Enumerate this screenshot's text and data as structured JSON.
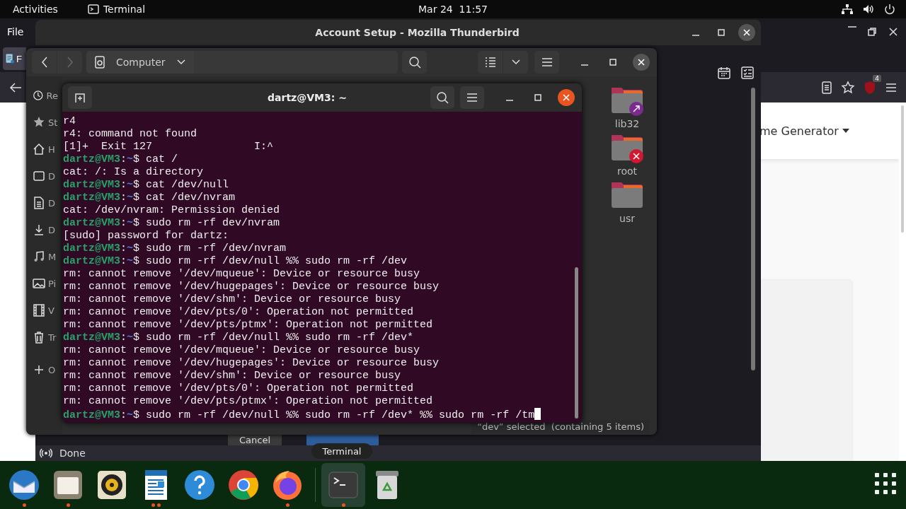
{
  "top_bar": {
    "activities": "Activities",
    "app": "Terminal",
    "clock": "Mar 24  11:57"
  },
  "browser": {
    "menu": "File",
    "tab_label": "F",
    "page_heading": "me Generator",
    "extension_badge": "4"
  },
  "thunderbird": {
    "title": "Account Setup - Mozilla Thunderbird",
    "buttons": [
      "Cancel"
    ],
    "status": "Done"
  },
  "files": {
    "location": "Computer",
    "sidebar": [
      {
        "kind": "recent",
        "label": "Re"
      },
      {
        "kind": "starred",
        "label": "St"
      },
      {
        "kind": "home",
        "label": "H"
      },
      {
        "kind": "desktop",
        "label": "D"
      },
      {
        "kind": "documents",
        "label": "D"
      },
      {
        "kind": "downloads",
        "label": "D"
      },
      {
        "kind": "music",
        "label": "M"
      },
      {
        "kind": "pictures",
        "label": "Pi"
      },
      {
        "kind": "videos",
        "label": "V"
      },
      {
        "kind": "trash",
        "label": "Tr"
      },
      {
        "kind": "other",
        "label": "O"
      }
    ],
    "folders": [
      {
        "kind": "link",
        "name": "lib32"
      },
      {
        "kind": "blocked",
        "name": "root"
      },
      {
        "kind": "plain",
        "name": "usr"
      }
    ],
    "status": "“dev” selected  (containing 5 items)"
  },
  "terminal": {
    "title": "dartz@VM3: ~",
    "cursor": true,
    "lines": [
      {
        "kind": "output",
        "text": "r4"
      },
      {
        "kind": "output",
        "text": "r4: command not found"
      },
      {
        "kind": "output",
        "text": "[1]+  Exit 127                I:^"
      },
      {
        "kind": "prompt",
        "user": "dartz@VM3",
        "colon": ":",
        "path": "~",
        "command": "$ cat /"
      },
      {
        "kind": "output",
        "text": "cat: /: Is a directory"
      },
      {
        "kind": "prompt",
        "user": "dartz@VM3",
        "colon": ":",
        "path": "~",
        "command": "$ cat /dev/null"
      },
      {
        "kind": "prompt",
        "user": "dartz@VM3",
        "colon": ":",
        "path": "~",
        "command": "$ cat /dev/nvram"
      },
      {
        "kind": "output",
        "text": "cat: /dev/nvram: Permission denied"
      },
      {
        "kind": "prompt",
        "user": "dartz@VM3",
        "colon": ":",
        "path": "~",
        "command": "$ sudo rm -rf dev/nvram"
      },
      {
        "kind": "output",
        "text": "[sudo] password for dartz:"
      },
      {
        "kind": "prompt",
        "user": "dartz@VM3",
        "colon": ":",
        "path": "~",
        "command": "$ sudo rm -rf /dev/nvram"
      },
      {
        "kind": "prompt",
        "user": "dartz@VM3",
        "colon": ":",
        "path": "~",
        "command": "$ sudo rm -rf /dev/null %% sudo rm -rf /dev"
      },
      {
        "kind": "output",
        "text": "rm: cannot remove '/dev/mqueue': Device or resource busy"
      },
      {
        "kind": "output",
        "text": "rm: cannot remove '/dev/hugepages': Device or resource busy"
      },
      {
        "kind": "output",
        "text": "rm: cannot remove '/dev/shm': Device or resource busy"
      },
      {
        "kind": "output",
        "text": "rm: cannot remove '/dev/pts/0': Operation not permitted"
      },
      {
        "kind": "output",
        "text": "rm: cannot remove '/dev/pts/ptmx': Operation not permitted"
      },
      {
        "kind": "prompt",
        "user": "dartz@VM3",
        "colon": ":",
        "path": "~",
        "command": "$ sudo rm -rf /dev/null %% sudo rm -rf /dev*"
      },
      {
        "kind": "output",
        "text": "rm: cannot remove '/dev/mqueue': Device or resource busy"
      },
      {
        "kind": "output",
        "text": "rm: cannot remove '/dev/hugepages': Device or resource busy"
      },
      {
        "kind": "output",
        "text": "rm: cannot remove '/dev/shm': Device or resource busy"
      },
      {
        "kind": "output",
        "text": "rm: cannot remove '/dev/pts/0': Operation not permitted"
      },
      {
        "kind": "output",
        "text": "rm: cannot remove '/dev/pts/ptmx': Operation not permitted"
      },
      {
        "kind": "prompt",
        "user": "dartz@VM3",
        "colon": ":",
        "path": "~",
        "command": "$ sudo rm -rf /dev/null %% sudo rm -rf /dev* %% sudo rm -rf /tm"
      }
    ]
  },
  "dock": {
    "tooltip": "Terminal",
    "apps": [
      {
        "kind": "mail",
        "running": true,
        "several": false,
        "selected": false
      },
      {
        "kind": "files",
        "running": true,
        "several": false,
        "selected": false
      },
      {
        "kind": "audio",
        "running": false,
        "selected": false
      },
      {
        "kind": "writer",
        "running": true,
        "several": true,
        "selected": false
      },
      {
        "kind": "help",
        "running": false,
        "selected": false
      },
      {
        "kind": "chrome",
        "running": false,
        "selected": false
      },
      {
        "kind": "firefox",
        "running": true,
        "several": false,
        "selected": false
      },
      {
        "kind": "separator"
      },
      {
        "kind": "terminal",
        "running": true,
        "several": false,
        "selected": true
      },
      {
        "kind": "recycle",
        "running": false,
        "selected": false
      }
    ]
  }
}
